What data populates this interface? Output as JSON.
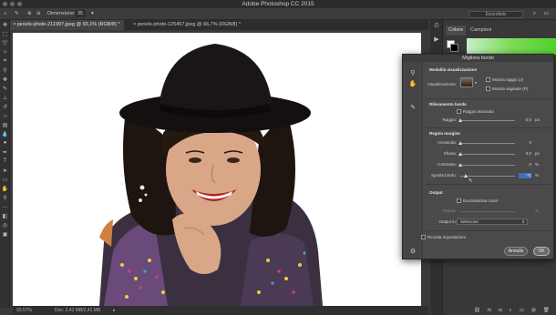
{
  "app": {
    "title": "Adobe Photoshop CC 2015"
  },
  "options_bar": {
    "dimension_label": "Dimensione:",
    "dimension_value": "35",
    "workspace": "Essentials"
  },
  "tabs": [
    {
      "label": "pexels-photo-211997.jpeg @ 93,1% (RGB/8) *"
    },
    {
      "label": "pexels-photo-125457.jpeg @ 66,7% (RGB/8) *"
    }
  ],
  "status": {
    "zoom": "93,57%",
    "doc": "Doc: 2,41 MB/2,41 MB"
  },
  "panel": {
    "tab_colore": "Colore",
    "tab_campioni": "Campioni"
  },
  "dialog": {
    "title": "Migliora bordo",
    "view_mode": {
      "section": "Modalità visualizzazione",
      "label": "Visualizzazione:",
      "show_radius": "Mostra raggio (J)",
      "show_original": "Mostra originale (P)"
    },
    "edge_detection": {
      "section": "Rilevamento bordo",
      "smart_radius": "Raggio avanzato",
      "radius_label": "Raggio:",
      "radius_value": "0,0",
      "radius_unit": "px"
    },
    "adjust_edge": {
      "section": "Regola margine",
      "smooth_label": "Arrotonda:",
      "smooth_value": "0",
      "feather_label": "Sfuma:",
      "feather_value": "0,0",
      "feather_unit": "px",
      "contrast_label": "Contrasto:",
      "contrast_value": "0",
      "contrast_unit": "%",
      "shift_label": "Sposta bordo:",
      "shift_value": "-71",
      "shift_unit": "%"
    },
    "output": {
      "section": "Output",
      "decontaminate": "Decontamina colori",
      "amount_label": "Fattore:",
      "amount_unit": "%",
      "output_to_label": "Output in:",
      "output_to_value": "Selezione"
    },
    "remember": "Ricorda impostazioni",
    "cancel": "Annulla",
    "ok": "OK"
  }
}
